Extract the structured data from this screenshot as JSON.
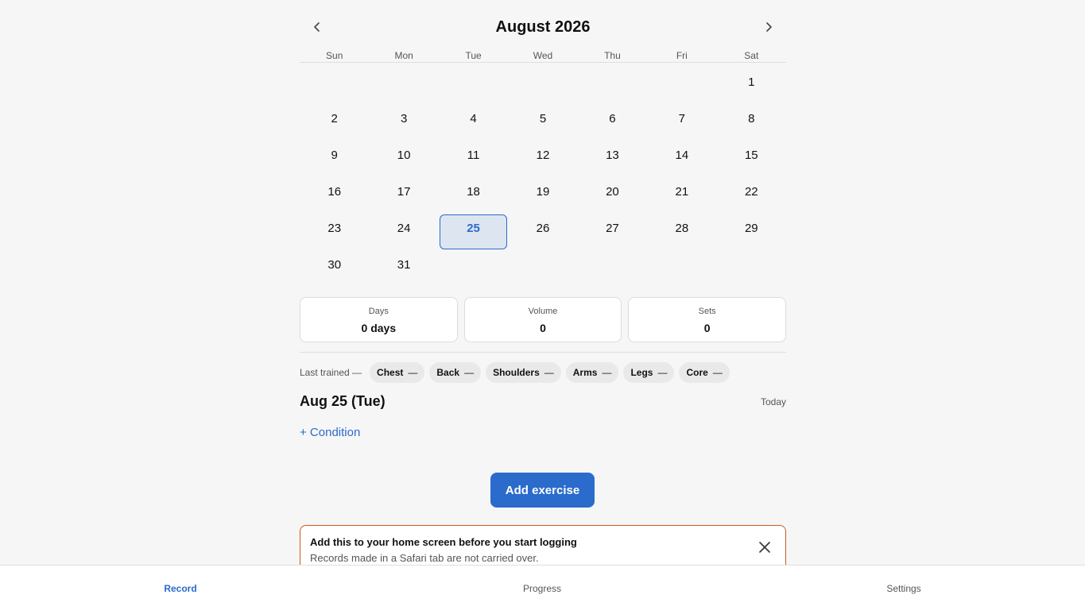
{
  "calendar": {
    "month_title": "August 2026",
    "weekdays": [
      "Sun",
      "Mon",
      "Tue",
      "Wed",
      "Thu",
      "Fri",
      "Sat"
    ],
    "leading_blanks": 6,
    "days": [
      "1",
      "2",
      "3",
      "4",
      "5",
      "6",
      "7",
      "8",
      "9",
      "10",
      "11",
      "12",
      "13",
      "14",
      "15",
      "16",
      "17",
      "18",
      "19",
      "20",
      "21",
      "22",
      "23",
      "24",
      "25",
      "26",
      "27",
      "28",
      "29",
      "30",
      "31"
    ],
    "selected_day": "25",
    "icons": {
      "prev": "chevron-left-icon",
      "next": "chevron-right-icon"
    }
  },
  "stats": [
    {
      "label": "Days",
      "value": "0 days"
    },
    {
      "label": "Volume",
      "value": "0"
    },
    {
      "label": "Sets",
      "value": "0"
    }
  ],
  "last_trained": {
    "label": "Last trained —",
    "chips": [
      {
        "name": "Chest",
        "value": "—"
      },
      {
        "name": "Back",
        "value": "—"
      },
      {
        "name": "Shoulders",
        "value": "—"
      },
      {
        "name": "Arms",
        "value": "—"
      },
      {
        "name": "Legs",
        "value": "—"
      },
      {
        "name": "Core",
        "value": "—"
      }
    ]
  },
  "day_detail": {
    "date_title": "Aug 25 (Tue)",
    "today_label": "Today",
    "condition_label": "+ Condition",
    "add_exercise_label": "Add exercise"
  },
  "banner": {
    "title": "Add this to your home screen before you start logging",
    "text": "Records made in a Safari tab are not carried over.",
    "close_icon": "close-icon"
  },
  "tabs": [
    {
      "label": "Record",
      "active": true
    },
    {
      "label": "Progress",
      "active": false
    },
    {
      "label": "Settings",
      "active": false
    }
  ],
  "colors": {
    "accent": "#2a6bcc",
    "banner_border": "#c65d1e",
    "selected_bg": "#dde5f0"
  }
}
